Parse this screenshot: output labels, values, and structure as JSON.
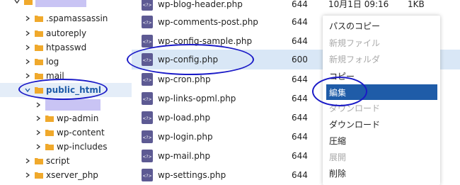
{
  "tree": {
    "items": [
      {
        "label": ".spamassassin",
        "expanded": false,
        "selected": false
      },
      {
        "label": "autoreply",
        "expanded": false,
        "selected": false
      },
      {
        "label": "htpasswd",
        "expanded": false,
        "selected": false
      },
      {
        "label": "log",
        "expanded": false,
        "selected": false
      },
      {
        "label": "mail",
        "expanded": false,
        "selected": false
      },
      {
        "label": "public_html",
        "expanded": true,
        "selected": true
      },
      {
        "label": "wp-admin",
        "expanded": false,
        "selected": false
      },
      {
        "label": "wp-content",
        "expanded": false,
        "selected": false
      },
      {
        "label": "wp-includes",
        "expanded": false,
        "selected": false
      },
      {
        "label": "script",
        "expanded": false,
        "selected": false
      },
      {
        "label": "xserver_php",
        "expanded": false,
        "selected": false
      }
    ]
  },
  "files": {
    "rows": [
      {
        "name": "wp-blog-header.php",
        "perm": "644",
        "date": "10月1日 09:16",
        "size": "1KB"
      },
      {
        "name": "wp-comments-post.php",
        "perm": "644",
        "date": "",
        "size": ""
      },
      {
        "name": "wp-config-sample.php",
        "perm": "644",
        "date": "",
        "size": ""
      },
      {
        "name": "wp-config.php",
        "perm": "600",
        "date": "",
        "size": ""
      },
      {
        "name": "wp-cron.php",
        "perm": "644",
        "date": "",
        "size": ""
      },
      {
        "name": "wp-links-opml.php",
        "perm": "644",
        "date": "",
        "size": ""
      },
      {
        "name": "wp-load.php",
        "perm": "644",
        "date": "",
        "size": ""
      },
      {
        "name": "wp-login.php",
        "perm": "644",
        "date": "",
        "size": ""
      },
      {
        "name": "wp-mail.php",
        "perm": "644",
        "date": "",
        "size": ""
      },
      {
        "name": "wp-settings.php",
        "perm": "644",
        "date": "",
        "size": ""
      }
    ],
    "selected_index": 3,
    "icon": "php-file-icon"
  },
  "context_menu": {
    "items": [
      {
        "label": "パスのコピー",
        "disabled": false
      },
      {
        "label": "新規ファイル",
        "disabled": true
      },
      {
        "label": "新規フォルダ",
        "disabled": true
      },
      {
        "label": "コピー",
        "disabled": false
      },
      {
        "label": "編集",
        "disabled": false,
        "highlighted": true
      },
      {
        "label": "ダウンロード",
        "disabled": true
      },
      {
        "label": "ダウンロード",
        "disabled": false
      },
      {
        "label": "圧縮",
        "disabled": false
      },
      {
        "label": "展開",
        "disabled": true
      },
      {
        "label": "削除",
        "disabled": false
      }
    ]
  },
  "colors": {
    "folder": "#f0a92c",
    "accent": "#1f5ca8",
    "selected_row": "#d9e7f6",
    "annotation": "#1a1ac7",
    "redaction": "#c9c4f4"
  }
}
